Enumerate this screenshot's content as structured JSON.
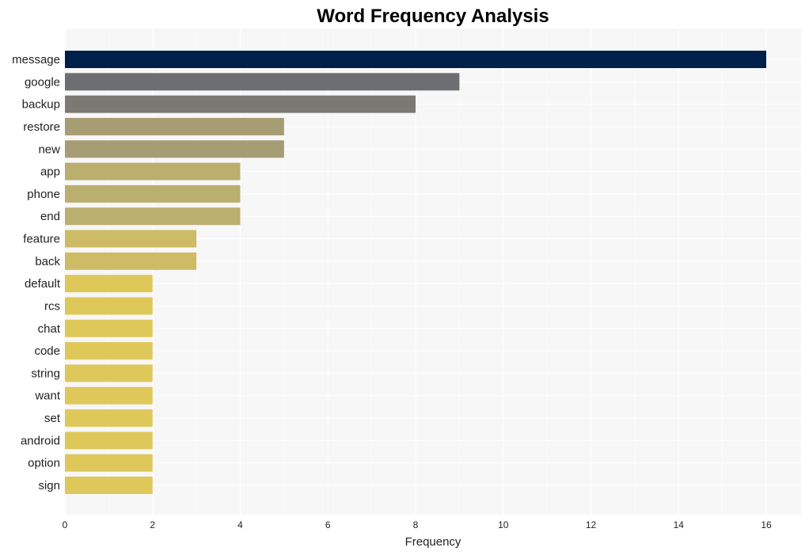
{
  "chart_data": {
    "type": "bar",
    "orientation": "horizontal",
    "title": "Word Frequency Analysis",
    "xlabel": "Frequency",
    "ylabel": "",
    "xlim": [
      0,
      16.8
    ],
    "xticks": [
      0,
      2,
      4,
      6,
      8,
      10,
      12,
      14,
      16
    ],
    "grid": true,
    "legend": "none",
    "categories": [
      "message",
      "google",
      "backup",
      "restore",
      "new",
      "app",
      "phone",
      "end",
      "feature",
      "back",
      "default",
      "rcs",
      "chat",
      "code",
      "string",
      "want",
      "set",
      "android",
      "option",
      "sign"
    ],
    "values": [
      16,
      9,
      8,
      5,
      5,
      4,
      4,
      4,
      3,
      3,
      2,
      2,
      2,
      2,
      2,
      2,
      2,
      2,
      2,
      2
    ],
    "colors": [
      "#00204c",
      "#6d6e72",
      "#7b7a75",
      "#a69d74",
      "#a69d74",
      "#baaf6f",
      "#baaf6f",
      "#baaf6f",
      "#cdbb66",
      "#cdbb66",
      "#dec85a",
      "#dec85a",
      "#dec85a",
      "#dec85a",
      "#dec85a",
      "#dec85a",
      "#dec85a",
      "#dec85a",
      "#dec85a",
      "#dec85a"
    ]
  }
}
